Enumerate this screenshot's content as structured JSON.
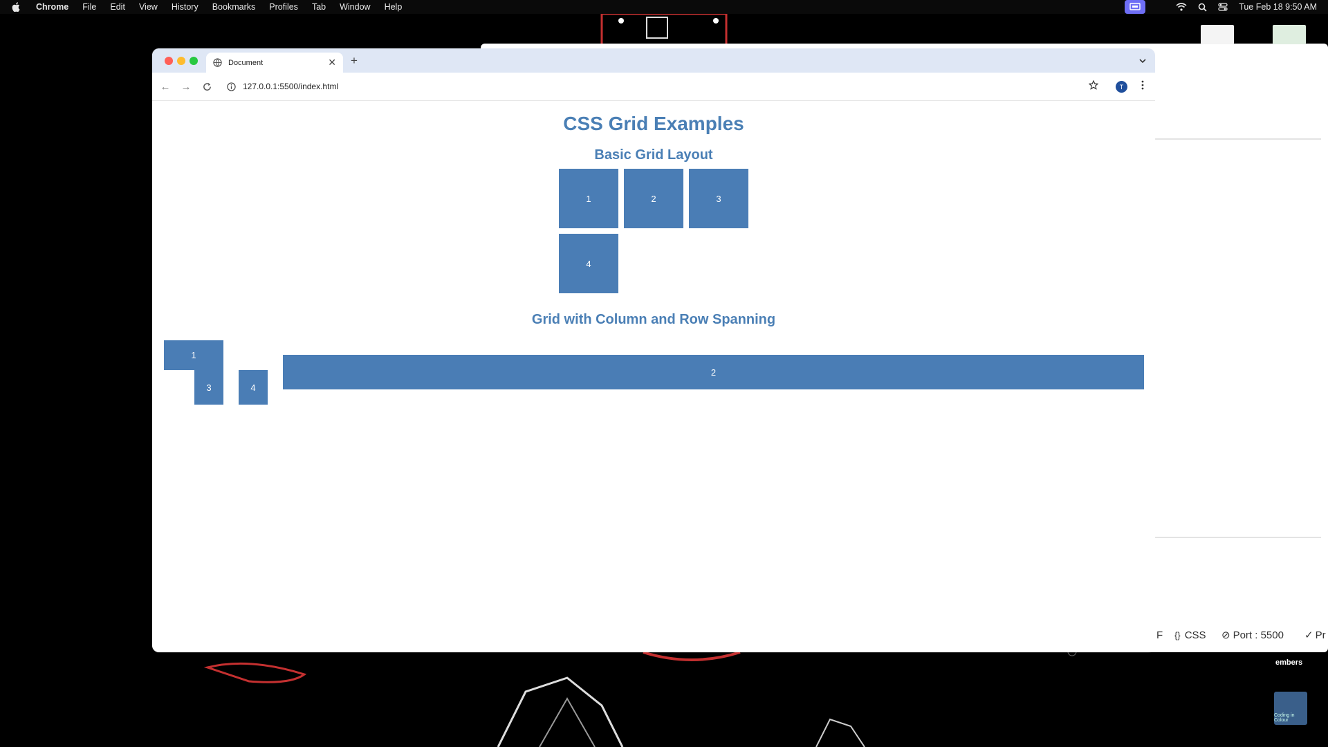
{
  "menubar": {
    "app_name": "Chrome",
    "items": [
      "File",
      "Edit",
      "View",
      "History",
      "Bookmarks",
      "Profiles",
      "Tab",
      "Window",
      "Help"
    ],
    "clock": "Tue Feb 18  9:50 AM"
  },
  "browser": {
    "tab_title": "Document",
    "new_tab": "+",
    "url": "127.0.0.1:5500/index.html",
    "profile_initial": "T"
  },
  "page": {
    "title": "CSS Grid Examples",
    "basic_heading": "Basic Grid Layout",
    "basic_items": [
      "1",
      "2",
      "3",
      "4"
    ],
    "spanning_heading": "Grid with Column and Row Spanning",
    "spanning_items": [
      "1",
      "2",
      "3",
      "4"
    ]
  },
  "background_window": {
    "status_f": "F",
    "status_css": "CSS",
    "status_port": "Port : 5500",
    "status_tail": "Pr",
    "embers_label": "embers",
    "logo_text": "Coding in Colour"
  },
  "colors": {
    "accent": "#4a7db5",
    "heading": "#4a7fb5",
    "tabstrip": "#dfe7f5"
  }
}
